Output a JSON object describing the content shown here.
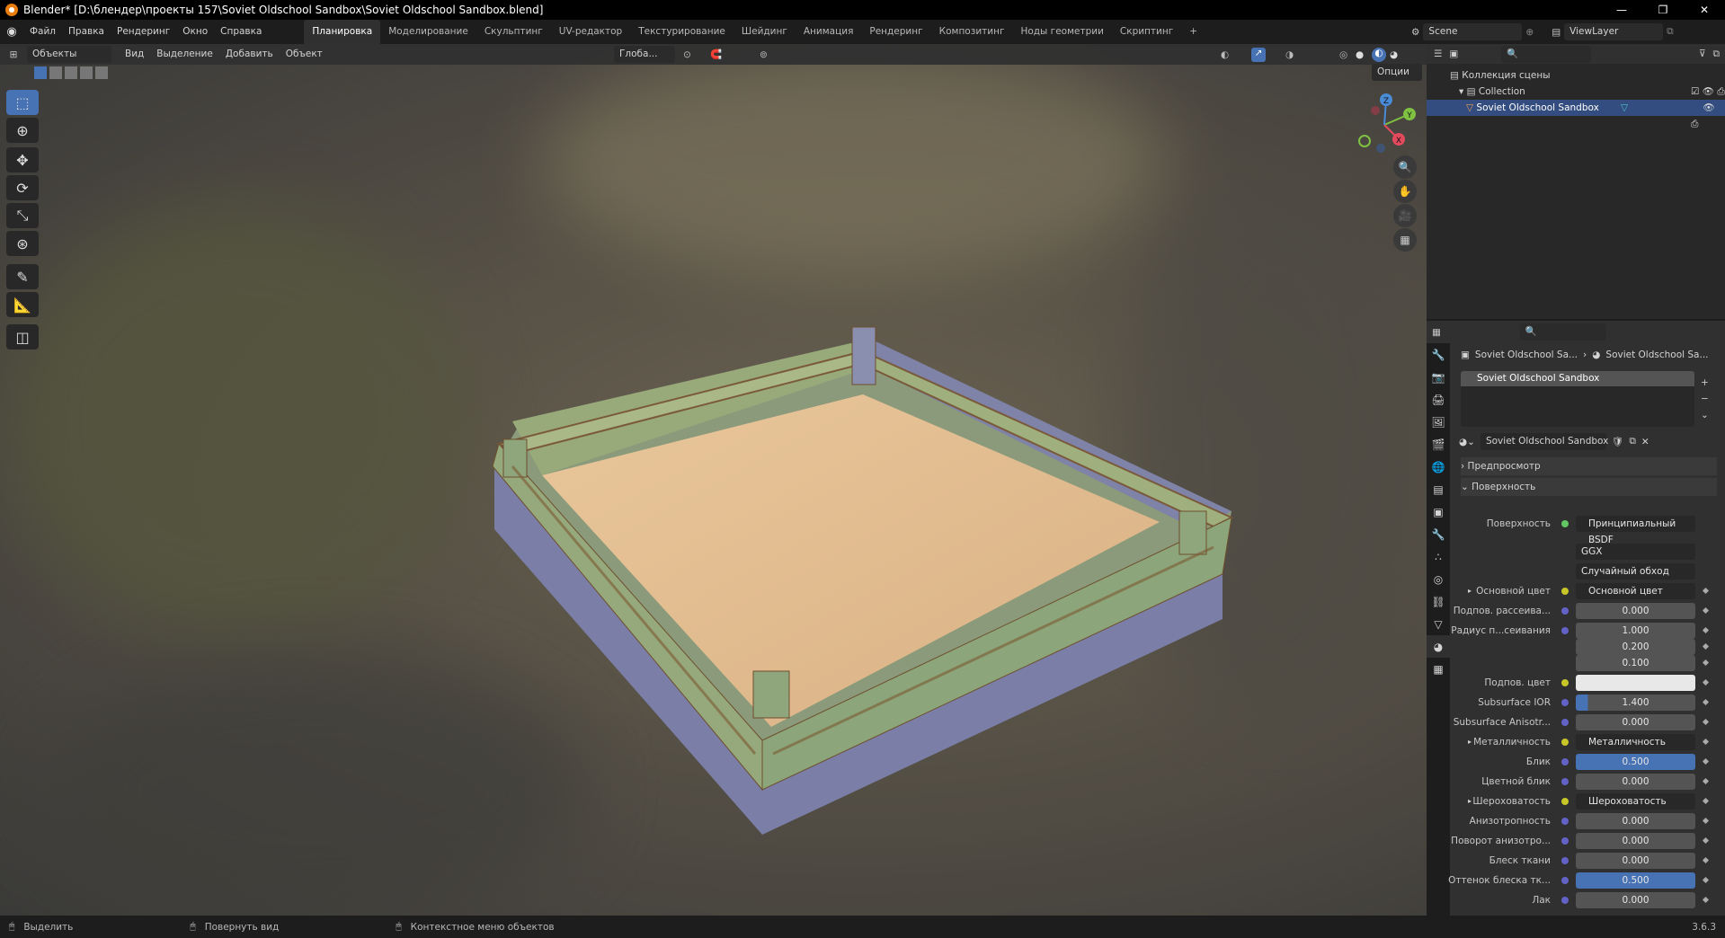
{
  "window": {
    "title": "Blender* [D:\\блендер\\проекты 157\\Soviet Oldschool Sandbox\\Soviet Oldschool Sandbox.blend]",
    "min": "—",
    "max": "❐",
    "close": "✕"
  },
  "menu": [
    "Файл",
    "Правка",
    "Рендеринг",
    "Окно",
    "Справка"
  ],
  "workspaces": [
    "Планировка",
    "Моделирование",
    "Скульптинг",
    "UV-редактор",
    "Текстурирование",
    "Шейдинг",
    "Анимация",
    "Рендеринг",
    "Композитинг",
    "Ноды геометрии",
    "Скриптинг"
  ],
  "scene": {
    "name": "Scene",
    "view_layer": "ViewLayer"
  },
  "viewport_header": {
    "mode": "Объекты",
    "menus": [
      "Вид",
      "Выделение",
      "Добавить",
      "Объект"
    ],
    "orientation": "Глоба...",
    "options": "Опции"
  },
  "outliner": {
    "root": "Коллекция сцены",
    "collection": "Collection",
    "object": "Soviet Oldschool Sandbox"
  },
  "properties": {
    "breadcrumb_object": "Soviet Oldschool Sa...",
    "breadcrumb_material": "Soviet Oldschool Sa...",
    "slot": "Soviet Oldschool Sandbox",
    "material_name": "Soviet Oldschool Sandbox",
    "panel_preview": "Предпросмотр",
    "panel_surface": "Поверхность",
    "surface_label": "Поверхность",
    "surface_value": "Принципиальный BSDF",
    "distribution": "GGX",
    "subsurface_method": "Случайный обход",
    "rows": [
      {
        "label": "Основной цвет",
        "value": "Основной цвет",
        "type": "link",
        "expand": true
      },
      {
        "label": "Подпов. рассеива...",
        "value": "0.000",
        "type": "num"
      },
      {
        "label": "Радиус п...сеивания",
        "value": "1.000",
        "type": "num"
      },
      {
        "label": "",
        "value": "0.200",
        "type": "num"
      },
      {
        "label": "",
        "value": "0.100",
        "type": "num"
      },
      {
        "label": "Подпов. цвет",
        "value": "",
        "type": "color"
      },
      {
        "label": "Subsurface IOR",
        "value": "1.400",
        "type": "num",
        "fill": 0.1
      },
      {
        "label": "Subsurface Anisotr...",
        "value": "0.000",
        "type": "num"
      },
      {
        "label": "Металличность",
        "value": "Металличность",
        "type": "link",
        "expand": true
      },
      {
        "label": "Блик",
        "value": "0.500",
        "type": "num",
        "fill": 1
      },
      {
        "label": "Цветной блик",
        "value": "0.000",
        "type": "num"
      },
      {
        "label": "Шероховатость",
        "value": "Шероховатость",
        "type": "link",
        "expand": true
      },
      {
        "label": "Анизотропность",
        "value": "0.000",
        "type": "num"
      },
      {
        "label": "Поворот анизотро...",
        "value": "0.000",
        "type": "num"
      },
      {
        "label": "Блеск ткани",
        "value": "0.000",
        "type": "num"
      },
      {
        "label": "Оттенок блеска тк...",
        "value": "0.500",
        "type": "num",
        "fill": 1
      },
      {
        "label": "Лак",
        "value": "0.000",
        "type": "num"
      }
    ]
  },
  "status": {
    "select": "Выделить",
    "rotate": "Повернуть вид",
    "context": "Контекстное меню объектов",
    "version": "3.6.3"
  },
  "gizmo": {
    "x": "X",
    "y": "Y",
    "z": "Z"
  }
}
